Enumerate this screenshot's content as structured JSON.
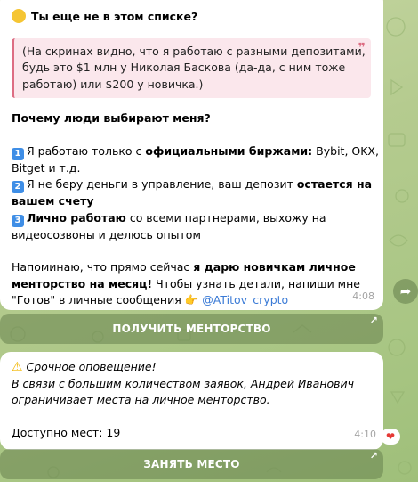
{
  "message1": {
    "title": "Ты еще не в этом списке?",
    "quote_lines": [
      "(На скринах видно, что я работаю с разными депозитами,",
      "будь это $1 млн у Николая Баскова (да-да, с ним тоже",
      "работаю) или $200 у новичка.)"
    ],
    "why_heading": "Почему люди выбирают меня?",
    "reason1": {
      "badge": "1",
      "pre": "Я работаю только с ",
      "bold": "официальными биржами:",
      "post": " Bybit, OKX,",
      "line2": "Bitget и т.д."
    },
    "reason2": {
      "badge": "2",
      "pre": "Я не беру деньги в управление, ваш депозит ",
      "bold1": "остается на",
      "bold2": "вашем счету"
    },
    "reason3": {
      "badge": "3",
      "bold": "Лично работаю",
      "post": " со всеми партнерами, выхожу на",
      "line2": "видеосозвоны и делюсь опытом"
    },
    "cta": {
      "pre": "Напоминаю, что прямо сейчас ",
      "bold1": "я дарю новичкам личное",
      "bold2": "менторство на месяц!",
      "post2": " Чтобы узнать детали, напиши мне",
      "line3": "\"Готов\" в личные сообщения ",
      "handle": "@ATitov_crypto"
    },
    "time": "4:08",
    "button": "ПОЛУЧИТЬ МЕНТОРСТВО"
  },
  "message2": {
    "alert_title": "Срочное оповещение!",
    "alert_line2": "В связи с большим количеством заявок, Андрей Иванович",
    "alert_line3": "ограничивает места на личное менторство.",
    "seats": "Доступно мест: 19",
    "time": "4:10",
    "reaction": "❤",
    "button": "ЗАНЯТЬ МЕСТО"
  },
  "icons": {
    "face": "flushed-face-emoji",
    "pointing": "👉",
    "share": "➦",
    "button_arrow": "↗",
    "quote_mark": "❞"
  }
}
